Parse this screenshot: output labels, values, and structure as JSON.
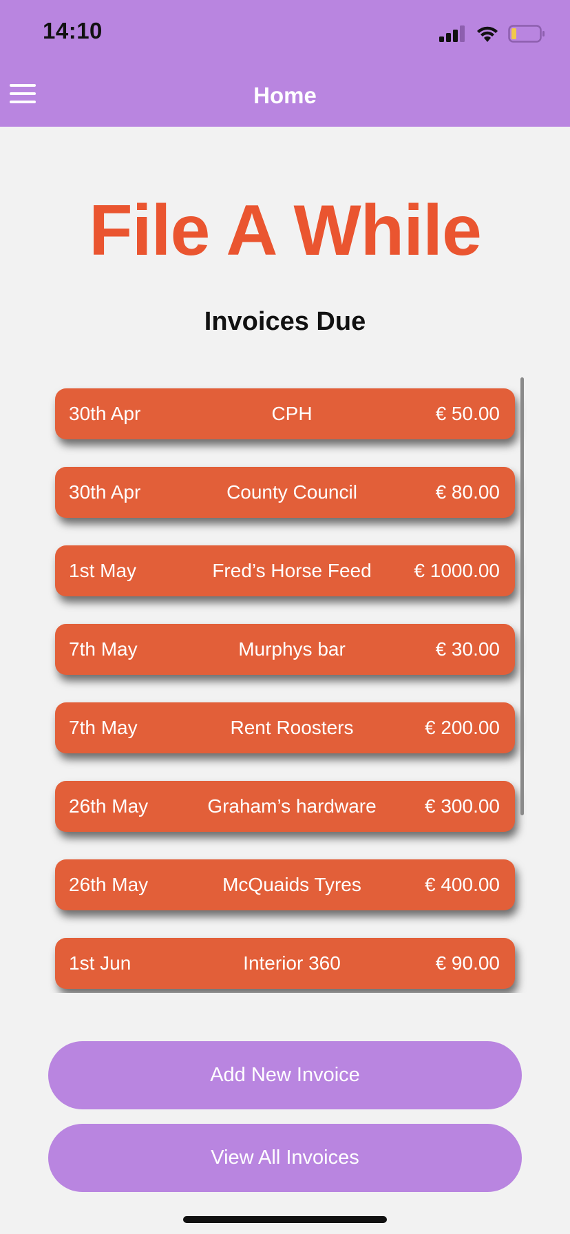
{
  "status_bar": {
    "time": "14:10"
  },
  "nav": {
    "title": "Home",
    "menu_icon": "hamburger-menu-icon"
  },
  "app": {
    "title": "File A While"
  },
  "invoices": {
    "heading": "Invoices Due",
    "items": [
      {
        "date": "30th Apr",
        "payee": "CPH",
        "amount": "€ 50.00"
      },
      {
        "date": "30th Apr",
        "payee": "County Council",
        "amount": "€ 80.00"
      },
      {
        "date": "1st May",
        "payee": "Fred’s Horse Feed",
        "amount": "€ 1000.00"
      },
      {
        "date": "7th May",
        "payee": "Murphys bar",
        "amount": "€ 30.00"
      },
      {
        "date": "7th May",
        "payee": "Rent Roosters",
        "amount": "€ 200.00"
      },
      {
        "date": "26th May",
        "payee": "Graham’s hardware",
        "amount": "€ 300.00"
      },
      {
        "date": "26th May",
        "payee": "McQuaids Tyres",
        "amount": "€ 400.00"
      },
      {
        "date": "1st Jun",
        "payee": "Interior 360",
        "amount": "€ 90.00"
      }
    ]
  },
  "actions": {
    "add_label": "Add New Invoice",
    "view_label": "View All Invoices"
  },
  "colors": {
    "header": "#b985e0",
    "accent": "#ea5530",
    "row": "#e25f39",
    "background": "#f2f2f2"
  }
}
